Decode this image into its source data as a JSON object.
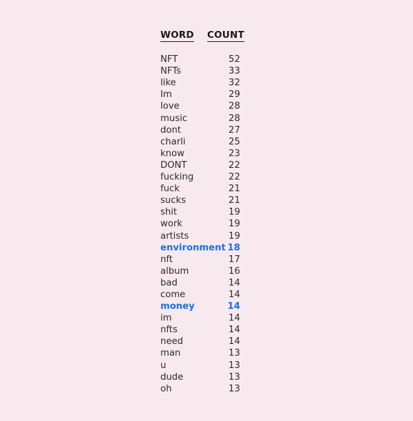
{
  "background_color": "#f7e9ed",
  "text_color": "#2b2b2b",
  "header_color": "#191919",
  "highlight_color": "#1a6ff0",
  "table": {
    "headers": {
      "word": "WORD",
      "count": "COUNT"
    },
    "rows": [
      {
        "word": "NFT",
        "count": "52",
        "highlight": false
      },
      {
        "word": "NFTs",
        "count": "33",
        "highlight": false
      },
      {
        "word": "like",
        "count": "32",
        "highlight": false
      },
      {
        "word": "Im",
        "count": "29",
        "highlight": false
      },
      {
        "word": "love",
        "count": "28",
        "highlight": false
      },
      {
        "word": "music",
        "count": "28",
        "highlight": false
      },
      {
        "word": "dont",
        "count": "27",
        "highlight": false
      },
      {
        "word": "charli",
        "count": "25",
        "highlight": false
      },
      {
        "word": "know",
        "count": "23",
        "highlight": false
      },
      {
        "word": "DONT",
        "count": "22",
        "highlight": false
      },
      {
        "word": "fucking",
        "count": "22",
        "highlight": false
      },
      {
        "word": "fuck",
        "count": "21",
        "highlight": false
      },
      {
        "word": "sucks",
        "count": "21",
        "highlight": false
      },
      {
        "word": "shit",
        "count": "19",
        "highlight": false
      },
      {
        "word": "work",
        "count": "19",
        "highlight": false
      },
      {
        "word": "artists",
        "count": "19",
        "highlight": false
      },
      {
        "word": "environment",
        "count": "18",
        "highlight": true
      },
      {
        "word": "nft",
        "count": "17",
        "highlight": false
      },
      {
        "word": "album",
        "count": "16",
        "highlight": false
      },
      {
        "word": "bad",
        "count": "14",
        "highlight": false
      },
      {
        "word": "come",
        "count": "14",
        "highlight": false
      },
      {
        "word": "money",
        "count": "14",
        "highlight": true
      },
      {
        "word": "im",
        "count": "14",
        "highlight": false
      },
      {
        "word": "nfts",
        "count": "14",
        "highlight": false
      },
      {
        "word": "need",
        "count": "14",
        "highlight": false
      },
      {
        "word": "man",
        "count": "13",
        "highlight": false
      },
      {
        "word": "u",
        "count": "13",
        "highlight": false
      },
      {
        "word": "dude",
        "count": "13",
        "highlight": false
      },
      {
        "word": "oh",
        "count": "13",
        "highlight": false
      }
    ]
  },
  "chart_data": {
    "type": "table",
    "title": "",
    "columns": [
      "WORD",
      "COUNT"
    ],
    "categories": [
      "NFT",
      "NFTs",
      "like",
      "Im",
      "love",
      "music",
      "dont",
      "charli",
      "know",
      "DONT",
      "fucking",
      "fuck",
      "sucks",
      "shit",
      "work",
      "artists",
      "environment",
      "nft",
      "album",
      "bad",
      "come",
      "money",
      "im",
      "nfts",
      "need",
      "man",
      "u",
      "dude",
      "oh"
    ],
    "values": [
      52,
      33,
      32,
      29,
      28,
      28,
      27,
      25,
      23,
      22,
      22,
      21,
      21,
      19,
      19,
      19,
      18,
      17,
      16,
      14,
      14,
      14,
      14,
      14,
      14,
      13,
      13,
      13,
      13
    ],
    "xlabel": "WORD",
    "ylabel": "COUNT",
    "ylim": [
      13,
      52
    ],
    "highlighted": [
      "environment",
      "money"
    ],
    "legend": []
  }
}
